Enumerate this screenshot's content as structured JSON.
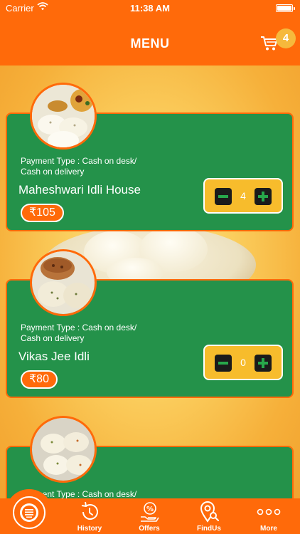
{
  "status_bar": {
    "carrier": "Carrier",
    "time": "11:38 AM"
  },
  "header": {
    "title": "MENU",
    "cart_count": "4"
  },
  "colors": {
    "primary": "#ff6a0a",
    "card_green": "#24924a",
    "accent_yellow": "#f7bc2c",
    "stepper_icon_green": "#27a74b"
  },
  "items": [
    {
      "payment_type": "Payment Type : Cash on desk/ Cash on delivery",
      "name": "Maheshwari Idli House",
      "price": "₹105",
      "quantity": "4"
    },
    {
      "payment_type": "Payment Type : Cash on desk/ Cash on delivery",
      "name": "Vikas Jee Idli",
      "price": "₹80",
      "quantity": "0"
    },
    {
      "payment_type": "Payment Type : Cash on desk/"
    }
  ],
  "tabbar": {
    "menu_icon": "menu-list-icon",
    "tabs": [
      {
        "label": "History",
        "icon": "history-icon"
      },
      {
        "label": "Offers",
        "icon": "offers-icon"
      },
      {
        "label": "FindUs",
        "icon": "location-search-icon"
      },
      {
        "label": "More",
        "icon": "more-dots-icon"
      }
    ]
  }
}
